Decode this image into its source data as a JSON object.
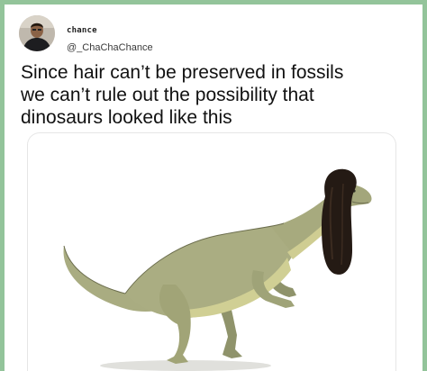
{
  "tweet": {
    "author": {
      "display_name": "chance",
      "handle": "@_ChaChaChance",
      "avatar_icon": "profile-photo-icon"
    },
    "text_lines": [
      "Since hair can’t be preserved in fossils",
      "we can’t rule out the possibility that",
      "dinosaurs looked like this"
    ],
    "media": {
      "image_icon": "dinosaur-with-wig-illustration"
    }
  },
  "colors": {
    "page_background": "#93c49a",
    "card_background": "#ffffff",
    "text": "#111111",
    "dino_skin": "#aaad82",
    "dino_belly": "#d0cf94",
    "hair": "#241a14"
  }
}
